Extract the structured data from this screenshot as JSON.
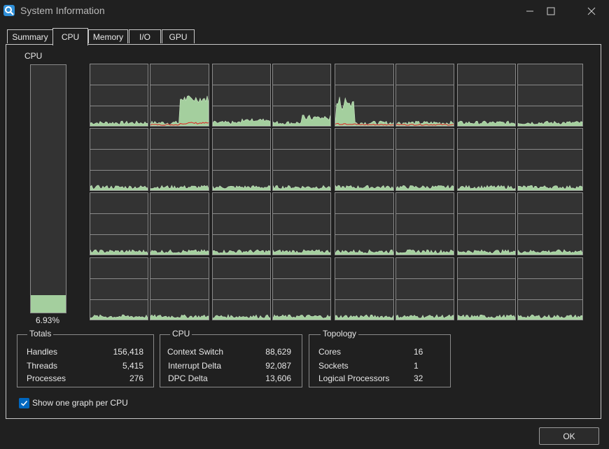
{
  "window": {
    "title": "System Information"
  },
  "tabs": [
    {
      "label": "Summary",
      "active": false
    },
    {
      "label": "CPU",
      "active": true
    },
    {
      "label": "Memory",
      "active": false
    },
    {
      "label": "I/O",
      "active": false
    },
    {
      "label": "GPU",
      "active": false
    }
  ],
  "cpu_meter": {
    "label": "CPU",
    "percent_text": "6.93%",
    "usage_percent": 6.93
  },
  "per_cpu_graphs": {
    "count": 32,
    "fill_color": "#a4cf9e",
    "kernel_color": "#e02020",
    "grid_color": "#8a8a8a"
  },
  "totals": {
    "title": "Totals",
    "rows": [
      {
        "label": "Handles",
        "value": "156,418"
      },
      {
        "label": "Threads",
        "value": "5,415"
      },
      {
        "label": "Processes",
        "value": "276"
      }
    ]
  },
  "cpu_stats": {
    "title": "CPU",
    "rows": [
      {
        "label": "Context Switch",
        "value": "88,629"
      },
      {
        "label": "Interrupt Delta",
        "value": "92,087"
      },
      {
        "label": "DPC Delta",
        "value": "13,606"
      }
    ]
  },
  "topology": {
    "title": "Topology",
    "rows": [
      {
        "label": "Cores",
        "value": "16"
      },
      {
        "label": "Sockets",
        "value": "1"
      },
      {
        "label": "Logical Processors",
        "value": "32"
      }
    ]
  },
  "options": {
    "show_one_graph_label": "Show one graph per CPU",
    "show_one_graph_checked": true
  },
  "buttons": {
    "ok": "OK"
  },
  "colors": {
    "accent": "#0067c0",
    "background": "#202020",
    "graph_bg": "#333333"
  }
}
